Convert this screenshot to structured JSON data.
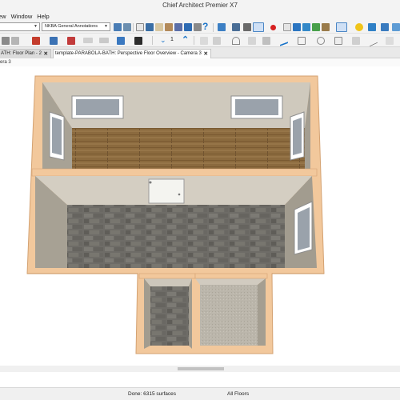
{
  "window": {
    "title": "Chief Architect Premier X7"
  },
  "menu": {
    "items": [
      "ew",
      "Window",
      "Help"
    ]
  },
  "toolbar": {
    "layer_dropdown_value": "",
    "annotation_set_value": "NKBA General Annotations",
    "zoom_number": "1"
  },
  "tabs": [
    {
      "label": "ATH: Floor Plan - 2",
      "close": "✕"
    },
    {
      "label": "template-PARABOLA-BATH: Perspective Floor Overview - Camera 3",
      "close": "✕"
    }
  ],
  "camera_label": "era 3",
  "status": {
    "done": "Done:  6315 surfaces",
    "floors": "All Floors"
  },
  "colors": {
    "accent_blue": "#1a74c9",
    "wall_top": "#f1c79b",
    "wall_inner": "#b8b0a0",
    "wood_floor": "#8a6a3c",
    "tile_floor": "#6d6b66",
    "carpet_floor": "#bdb8ae"
  },
  "icons": [
    "search-icon",
    "help-icon",
    "camera-icon",
    "arrow-up-icon",
    "sun-icon",
    "circle-icon",
    "line-tool-icon"
  ]
}
